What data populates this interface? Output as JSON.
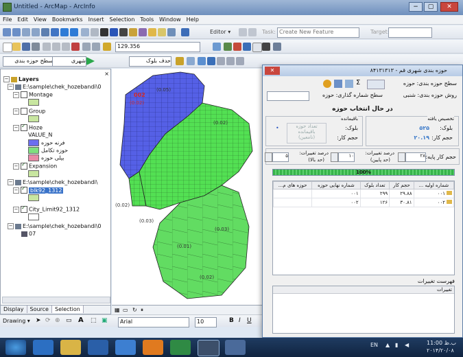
{
  "app": {
    "title": "Untitled - ArcMap - ArcInfo",
    "window_buttons": [
      "−",
      "▢",
      "✕"
    ]
  },
  "menu": [
    "File",
    "Edit",
    "View",
    "Bookmarks",
    "Insert",
    "Selection",
    "Tools",
    "Window",
    "Help"
  ],
  "toolbar1": {
    "editor_label": "Editor ▾",
    "task_label": "Task:",
    "task_value": "Create New Feature",
    "target_label": "Target:"
  },
  "toolbar2": {
    "scale_value": "129.356"
  },
  "toolbar3": {
    "field1": "سطح حوزه بندی",
    "field2": "شهری",
    "field3": "حدف بلوک"
  },
  "toc": {
    "root": "Layers",
    "path1": "E:\\sample\\chek_hozebandi\\0",
    "montage": "Montage",
    "group": "Group",
    "hoze": "Hoze",
    "value_n": "VALUE_N",
    "legend": [
      {
        "label": "فرنه حوزه",
        "color": "#6b6ff0"
      },
      {
        "label": "حوزه تکامل",
        "color": "#7fe07f"
      },
      {
        "label": "بیلی حوزه",
        "color": "#e88aa6"
      }
    ],
    "expansion": "Expansion",
    "path2": "E:\\sample\\chek_hozebandi\\",
    "layer_selected": "blk92_1312",
    "city_limit": "City_Limit92_1312",
    "path3": "E:\\sample\\chek_hozebandi\\0",
    "item07": "07"
  },
  "toc_tabs": [
    "Display",
    "Source",
    "Selection"
  ],
  "drawing": {
    "label": "Drawing ▾",
    "font": "Arial",
    "size": "10"
  },
  "map_labels": [
    "002",
    "(0.02)",
    "(0.05)",
    "(0.02)",
    "(0.03)",
    "(0.02)",
    "(0.03)",
    "(0.01)",
    "(0.02)"
  ],
  "dialog": {
    "title": "حوزه بندی شهری قم - ۸۴۱۳۱۳۱۳",
    "row1_label": "سطح حوزه بندی: حوزه",
    "row2_a": "سطح شماره گذاری: حوزه",
    "row2_b": "روش حوزه بندی: شنبی",
    "status": "در حال انتخاب حوزه",
    "group_assigned": "تخصیص یافته",
    "group_remaining": "باقیمانده",
    "block_label": "بلوک:",
    "block_value": "۵۲۵",
    "work_label": "حجم کار:",
    "work_value": "۲۰.۱۹",
    "rem_block_label": "بلوک:",
    "rem_work_label": "حجم کار:",
    "count_label": "تعداد حوزه باقیمانده",
    "count_value": "(نامعین)",
    "load_label": "حجم کار پایه:",
    "load_value": "۲۸",
    "change_label": "درصد تغییرات:",
    "change_value": "۱۰",
    "change_note": "(حد پایین)",
    "change2_label": "درصد تغییرات:",
    "change2_value": "۵",
    "change2_note": "(حد بالا)",
    "progress_pct": 100,
    "progress_text": "100%",
    "table_headers": [
      "شماره اولیه ...",
      "حجم کار",
      "تعداد بلوک",
      "شماره نهایی حوزه",
      "حوزه های م..."
    ],
    "table_rows": [
      [
        "۰۰۱",
        "۲۹.۸۸",
        "۲۹۹",
        "۰۰۱",
        ""
      ],
      [
        "۰۰۲",
        "۳۰.۸۱",
        "۱۲۶",
        "۰۰۲",
        ""
      ]
    ],
    "list_title": "فهرست تغییرات",
    "list_header": "تغییرات"
  },
  "taskbar": {
    "lang": "EN",
    "time": "11:00 ب.ظ",
    "date": "۲۰۱۴/۲۰/۰۸"
  },
  "colors": {
    "blue_zone": "#5560e6",
    "green_zone": "#53e053",
    "dialog_border": "#5d7ea8"
  }
}
